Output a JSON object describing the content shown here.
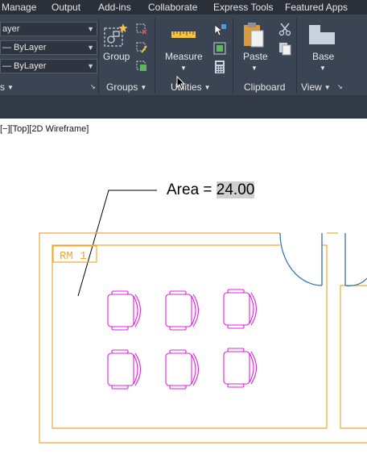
{
  "menubar": {
    "items": [
      "Manage",
      "Output",
      "Add-ins",
      "Collaborate",
      "Express Tools",
      "Featured Apps"
    ]
  },
  "layer_dropdowns": {
    "row1": "ayer",
    "row2": "— ByLayer",
    "row3": "— ByLayer"
  },
  "ribbon": {
    "properties_label_partial": "s",
    "group_button_label": "Group",
    "groups_panel_label": "Groups",
    "measure_button_label": "Measure",
    "utilities_panel_label": "Utilities",
    "paste_button_label": "Paste",
    "clipboard_panel_label": "Clipboard",
    "base_button_label": "Base",
    "view_panel_label": "View"
  },
  "viewport": {
    "label": "[−][Top][2D Wireframe]"
  },
  "drawing": {
    "area_prefix": "Area = ",
    "area_value": "24.00",
    "room_tag": "RM  1"
  },
  "colors": {
    "walls": "#f0a830",
    "chairs": "#e020e0",
    "door": "#2e6db4",
    "leader": "#000000",
    "ribbon_bg": "#3b4453",
    "menubar_bg": "#2b2f38"
  }
}
